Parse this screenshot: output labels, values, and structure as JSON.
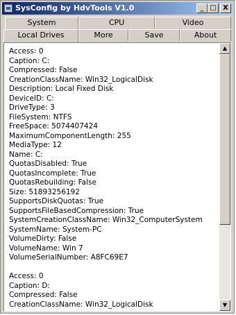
{
  "window": {
    "title": "SysConfig by HdvTools V1.0",
    "controls": {
      "minimize": "_",
      "maximize": "□",
      "close": "X"
    }
  },
  "tabs": {
    "row1": [
      "System",
      "CPU",
      "Video"
    ],
    "row2": [
      "Local Drives",
      "More",
      "Save",
      "About"
    ],
    "active": "Local Drives"
  },
  "drives": [
    {
      "lines": [
        "Access:  0",
        "Caption:  C:",
        "Compressed:  False",
        "CreationClassName:  Win32_LogicalDisk",
        "Description:  Local Fixed Disk",
        "DeviceID:  C:",
        "DriveType:  3",
        "FileSystem:  NTFS",
        "FreeSpace:  5074407424",
        "MaximumComponentLength:  255",
        "MediaType:  12",
        "Name:  C:",
        "QuotasDisabled:  True",
        "QuotasIncomplete:  True",
        "QuotasRebuilding:  False",
        "Size:  51893256192",
        "SupportsDiskQuotas:  True",
        "SupportsFileBasedCompression:  True",
        "SystemCreationClassName:  Win32_ComputerSystem",
        "SystemName:  System-PC",
        "VolumeDirty:  False",
        "VolumeName:  Win 7",
        "VolumeSerialNumber:  A8FC69E7"
      ]
    },
    {
      "lines": [
        "Access:  0",
        "Caption:  D:",
        "Compressed:  False",
        "CreationClassName:  Win32_LogicalDisk"
      ]
    }
  ],
  "scrollbar": {
    "up_arrow": "▲",
    "down_arrow": "▼"
  }
}
